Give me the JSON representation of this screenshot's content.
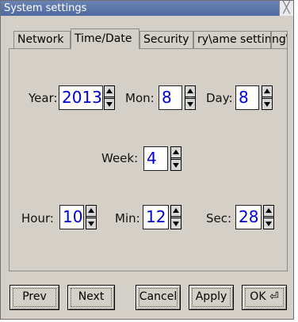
{
  "window": {
    "title": "System settings",
    "close_glyph": "╳"
  },
  "tabs": [
    {
      "label": "Network",
      "active": false
    },
    {
      "label": "Time/Date",
      "active": true
    },
    {
      "label": "Security",
      "active": false
    },
    {
      "label": "ry\\ame setting",
      "active": false
    },
    {
      "label": "ng\\",
      "active": false
    }
  ],
  "fields": {
    "year": {
      "label": "Year:",
      "value": "2013"
    },
    "mon": {
      "label": "Mon:",
      "value": "8"
    },
    "day": {
      "label": "Day:",
      "value": "8"
    },
    "week": {
      "label": "Week:",
      "value": "4"
    },
    "hour": {
      "label": "Hour:",
      "value": "10"
    },
    "min": {
      "label": "Min:",
      "value": "12"
    },
    "sec": {
      "label": "Sec:",
      "value": "28"
    }
  },
  "buttons": {
    "prev": "Prev",
    "next": "Next",
    "cancel": "Cancel",
    "apply": "Apply",
    "ok": "OK ⏎"
  },
  "colors": {
    "titlebar": "#5a74a8",
    "window_bg": "#d4d0c8",
    "value_text": "#0000d8"
  }
}
